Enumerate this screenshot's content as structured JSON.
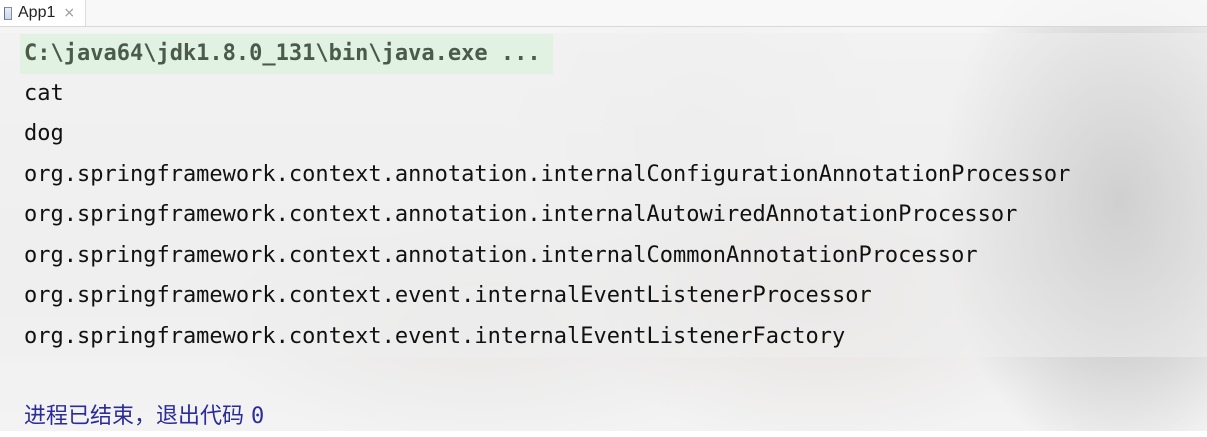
{
  "tab": {
    "label": "App1",
    "close_glyph": "×",
    "icon": "java-class-file-icon"
  },
  "console": {
    "command": "C:\\java64\\jdk1.8.0_131\\bin\\java.exe ...",
    "output_lines": [
      "cat",
      "dog",
      "org.springframework.context.annotation.internalConfigurationAnnotationProcessor",
      "org.springframework.context.annotation.internalAutowiredAnnotationProcessor",
      "org.springframework.context.annotation.internalCommonAnnotationProcessor",
      "org.springframework.context.event.internalEventListenerProcessor",
      "org.springframework.context.event.internalEventListenerFactory"
    ],
    "exit_message": "进程已结束，退出代码",
    "exit_code": "0"
  },
  "colors": {
    "command_highlight": "#e0f2e0",
    "exit_text": "#2b2b9a",
    "output_text": "#111111"
  }
}
